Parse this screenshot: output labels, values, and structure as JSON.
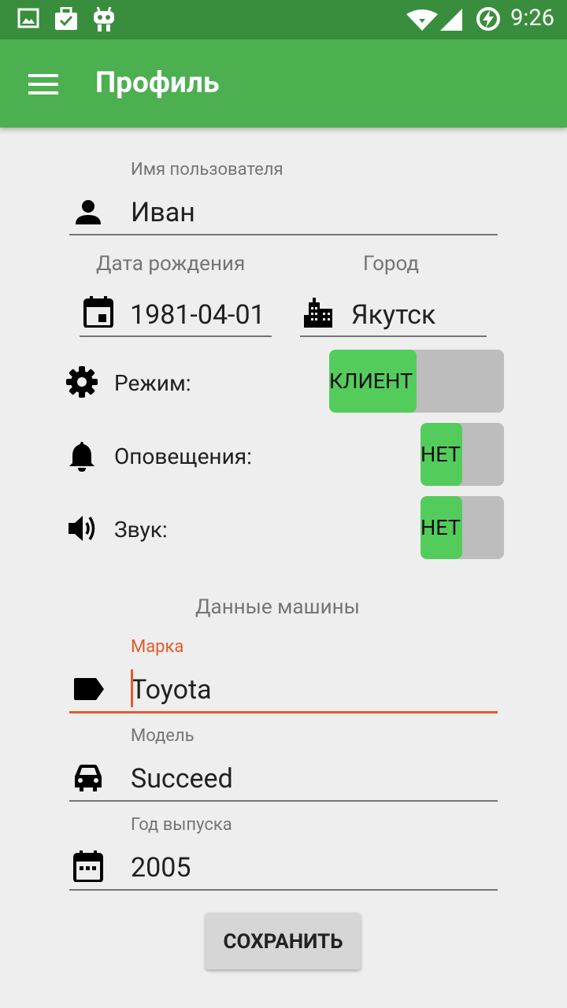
{
  "status_bar": {
    "time": "9:26"
  },
  "app_bar": {
    "title": "Профиль"
  },
  "profile": {
    "username_label": "Имя пользователя",
    "username_value": "Иван",
    "birthdate_label": "Дата рождения",
    "birthdate_value": "1981-04-01",
    "city_label": "Город",
    "city_value": "Якутск"
  },
  "settings": {
    "mode_label": "Режим:",
    "mode_value": "КЛИЕНТ",
    "notifications_label": "Оповещения:",
    "notifications_value": "НЕТ",
    "sound_label": "Звук:",
    "sound_value": "НЕТ"
  },
  "car": {
    "section_title": "Данные машины",
    "brand_label": "Марка",
    "brand_value": "Toyota",
    "model_label": "Модель",
    "model_value": "Succeed",
    "year_label": "Год выпуска",
    "year_value": "2005"
  },
  "actions": {
    "save_label": "СОХРАНИТЬ"
  },
  "colors": {
    "status_bar": "#388e3c",
    "app_bar": "#4caf50",
    "accent": "#e65a2b",
    "toggle_on": "#54cc5c",
    "toggle_track": "#bdbdbd"
  }
}
